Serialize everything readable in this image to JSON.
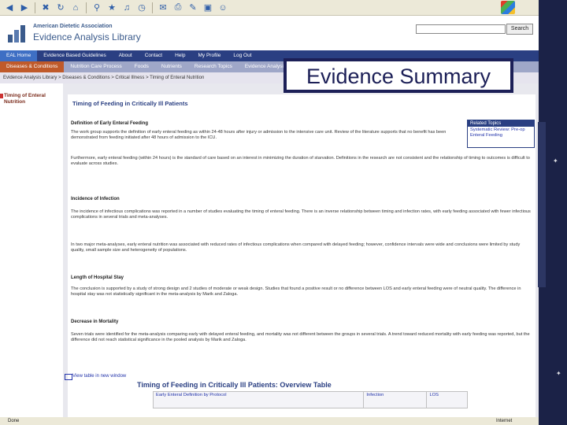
{
  "toolbar": {
    "icons": [
      "back-icon",
      "forward-icon",
      "stop-icon",
      "refresh-icon",
      "home-icon",
      "search-icon",
      "favorites-icon",
      "media-icon",
      "history-icon",
      "mail-icon",
      "print-icon",
      "edit-icon",
      "discuss-icon",
      "messenger-icon"
    ]
  },
  "header": {
    "org": "American Dietetic Association",
    "library": "Evidence Analysis Library",
    "search_button": "Search",
    "search_value": ""
  },
  "nav_primary": [
    "EAL Home",
    "Evidence Based Guidelines",
    "About",
    "Contact",
    "Help",
    "My Profile",
    "Log Out"
  ],
  "nav_secondary": [
    "Diseases & Conditions",
    "Nutrition Care Process",
    "Foods",
    "Nutrients",
    "Research Topics",
    "Evidence Analysis Process"
  ],
  "breadcrumb": "Evidence Analysis Library > Diseases & Conditions > Critical Illness > Timing of Enteral Nutrition",
  "left_panel": {
    "title": "Timing of Enteral Nutrition"
  },
  "article": {
    "title": "Timing of Feeding in Critically Ill Patients",
    "sections": [
      {
        "heading": "Definition of Early Enteral Feeding",
        "paragraphs": [
          "The work group supports the definition of early enteral feeding as within 24-48 hours after injury or admission to the intensive care unit. Review of the literature supports that no benefit has been demonstrated from feeding initiated after 48 hours of admission to the ICU.",
          "Furthermore, early enteral feeding (within 24 hours) is the standard of care based on an interest in minimizing the duration of starvation. Definitions in the research are not consistent and the relationship of timing to outcomes is difficult to evaluate across studies."
        ]
      },
      {
        "heading": "Incidence of Infection",
        "paragraphs": [
          "The incidence of infectious complications was reported in a number of studies evaluating the timing of enteral feeding. There is an inverse relationship between timing and infection rates, with early feeding associated with fewer infectious complications in several trials and meta-analyses.",
          "In two major meta-analyses, early enteral nutrition was associated with reduced rates of infectious complications when compared with delayed feeding; however, confidence intervals were wide and conclusions were limited by study quality, small sample size and heterogeneity of populations."
        ]
      },
      {
        "heading": "Length of Hospital Stay",
        "paragraphs": [
          "The conclusion is supported by a study of strong design and 2 studies of moderate or weak design. Studies that found a positive result or no difference between LOS and early enteral feeding were of neutral quality. The difference in hospital stay was not statistically significant in the meta-analysis by Marik and Zaloga."
        ]
      },
      {
        "heading": "Decrease in Mortality",
        "paragraphs": [
          "Seven trials were identified for the meta-analysis comparing early with delayed enteral feeding, and mortality was not different between the groups in several trials. A trend toward reduced mortality with early feeding was reported, but the difference did not reach statistical significance in the pooled analysis by Marik and Zaloga."
        ]
      }
    ],
    "new_window_link": "View table in new window",
    "overview_title": "Timing of Feeding in Critically Ill Patients: Overview Table",
    "overview_headers": [
      "Early Enteral Definition by Protocol",
      "Infection",
      "LOS"
    ]
  },
  "related": {
    "heading": "Related Topics",
    "link": "Systematic Review: Pre-op Enteral Feeding"
  },
  "overlay": {
    "label": "Evidence Summary"
  },
  "status": {
    "left": "Done",
    "right": "Internet"
  }
}
